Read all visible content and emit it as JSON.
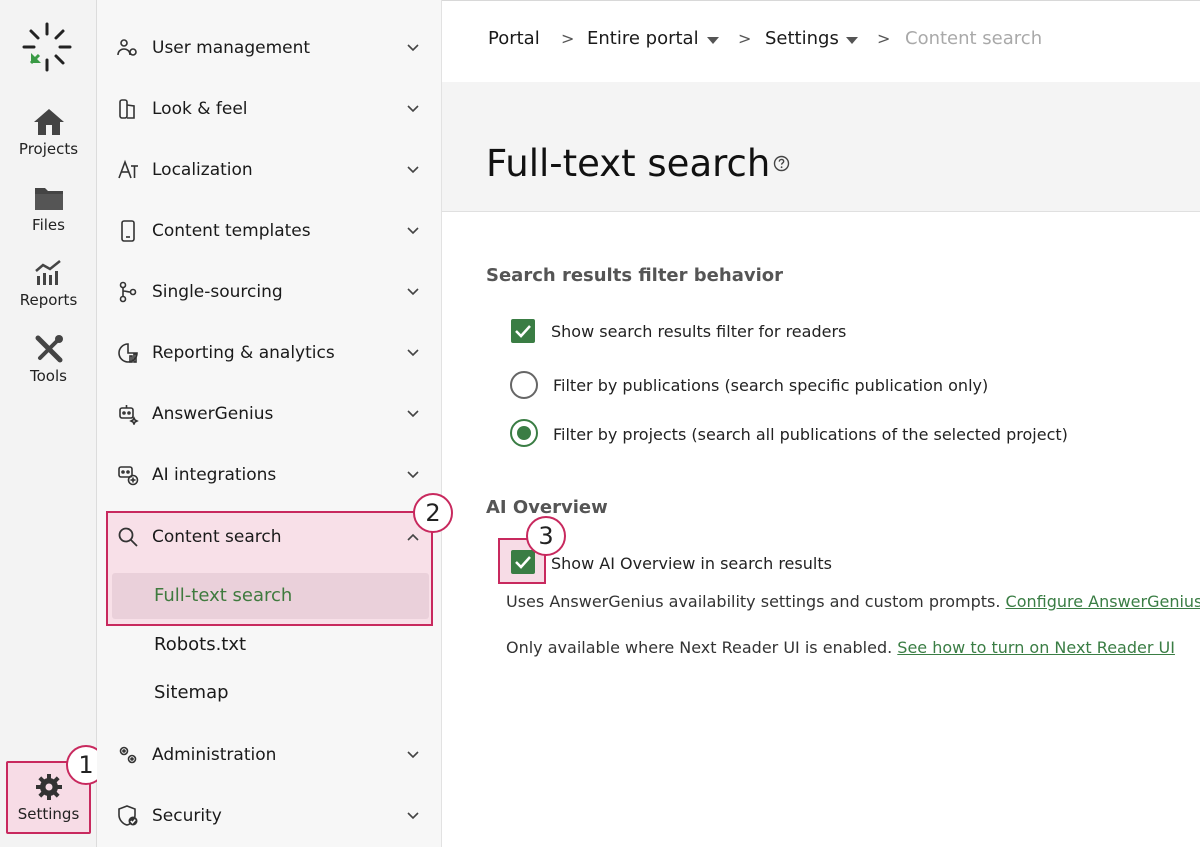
{
  "rail": {
    "items": [
      {
        "label": "Projects",
        "icon": "home-icon"
      },
      {
        "label": "Files",
        "icon": "folder-icon"
      },
      {
        "label": "Reports",
        "icon": "chart-icon"
      },
      {
        "label": "Tools",
        "icon": "tools-icon"
      }
    ],
    "settings_label": "Settings"
  },
  "badges": {
    "one": "1",
    "two": "2",
    "three": "3"
  },
  "nav": {
    "items": [
      {
        "label": "User management"
      },
      {
        "label": "Look & feel"
      },
      {
        "label": "Localization"
      },
      {
        "label": "Content templates"
      },
      {
        "label": "Single-sourcing"
      },
      {
        "label": "Reporting & analytics"
      },
      {
        "label": "AnswerGenius"
      },
      {
        "label": "AI integrations"
      },
      {
        "label": "Content search"
      },
      {
        "label": "Administration"
      },
      {
        "label": "Security"
      }
    ],
    "content_search_children": [
      "Full-text search",
      "Robots.txt",
      "Sitemap"
    ]
  },
  "breadcrumb": {
    "portal": "Portal",
    "entire_portal": "Entire portal",
    "settings": "Settings",
    "current": "Content search",
    "separator": ">"
  },
  "page": {
    "title": "Full-text search"
  },
  "filter_section": {
    "title": "Search results filter behavior",
    "show_filter_label": "Show search results filter for readers",
    "show_filter_checked": true,
    "options": [
      {
        "label": "Filter by publications (search specific publication only)",
        "selected": false
      },
      {
        "label": "Filter by projects (search all publications of the selected project)",
        "selected": true
      }
    ]
  },
  "ai_section": {
    "title": "AI Overview",
    "show_ai_label": "Show AI Overview in search results",
    "show_ai_checked": true,
    "note1_text": "Uses AnswerGenius availability settings and custom prompts.",
    "note1_link": "Configure AnswerGenius",
    "note2_text": "Only available where Next Reader UI is enabled.",
    "note2_link": "See how to turn on Next Reader UI"
  },
  "colors": {
    "accent": "#3a7d44",
    "highlight": "#c8295e",
    "highlight_bg": "#f8e0e8"
  }
}
